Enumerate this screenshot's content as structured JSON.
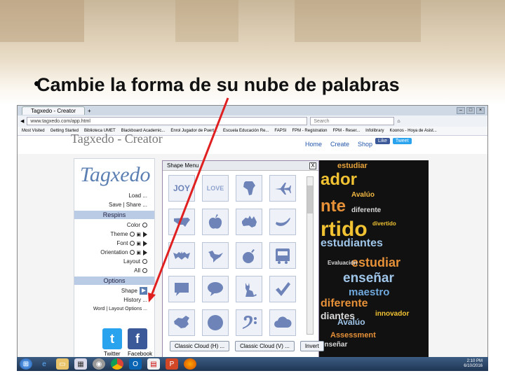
{
  "slide": {
    "bullet": "•",
    "title": "Cambie la forma de su nube de palabras"
  },
  "browser": {
    "tab_label": "Tagxedo - Creator",
    "new_tab": "+",
    "url": "www.tagxedo.com/app.html",
    "search_placeholder": "Search",
    "window_buttons": [
      "–",
      "□",
      "×"
    ],
    "bookmarks": [
      "Most Visited",
      "Getting Started",
      "Biblioteca UMET",
      "Blackboard Academic...",
      "Enrol Jugador de Puert...",
      "Escuela Educación Re...",
      "FAPSI",
      "FPM - Registration",
      "FPM - Reser...",
      "Infolibrary",
      "Koonos - Hoya de Asist..."
    ]
  },
  "site": {
    "logo": "Tagxedo - Creator",
    "nav": [
      "Home",
      "Create",
      "Shop"
    ],
    "social_small": [
      "Like",
      "Tweet"
    ]
  },
  "left_panel": {
    "logo": "Tagxedo",
    "load": "Load ...",
    "save_share": "Save | Share ...",
    "respins": "Respins",
    "color": "Color",
    "theme": "Theme",
    "font": "Font",
    "orientation": "Orientation",
    "layout": "Layout",
    "all": "All",
    "options": "Options",
    "shape": "Shape",
    "history": "History ...",
    "word_layout": "Word | Layout Options ...",
    "twitter": "Twitter",
    "facebook": "Facebook"
  },
  "shape_menu": {
    "title": "Shape Menu",
    "close": "X",
    "cells": [
      "JOY",
      "LOVE",
      "africa-icon",
      "airplane-icon",
      "usa-icon",
      "apple-icon",
      "australia-icon",
      "banana-icon",
      "bat-icon",
      "bird-icon",
      "bomb-icon",
      "bus-icon",
      "speech-bubble-icon",
      "speech-bubble-2-icon",
      "cat-icon",
      "checkmark-icon",
      "china-icon",
      "circle-icon",
      "bass-clef-icon",
      "cloud-icon"
    ],
    "buttons": [
      "Classic Cloud (H) ...",
      "Classic Cloud (V) ...",
      "Invert"
    ]
  },
  "word_cloud": [
    {
      "text": "estudiar",
      "color": "#e8a33a"
    },
    {
      "text": "ador",
      "color": "#f1c232"
    },
    {
      "text": "nte",
      "color": "#e69138"
    },
    {
      "text": "Avalúo",
      "color": "#f4b942"
    },
    {
      "text": "diferente",
      "color": "#d9d9d9"
    },
    {
      "text": "rtido",
      "color": "#f1c232"
    },
    {
      "text": "estudiantes",
      "color": "#9fc5e8"
    },
    {
      "text": "estudiar",
      "color": "#e69138"
    },
    {
      "text": "enseñar",
      "color": "#9fc5e8"
    },
    {
      "text": "maestro",
      "color": "#6fa8dc"
    },
    {
      "text": "diferente",
      "color": "#e69138"
    },
    {
      "text": "diantes",
      "color": "#d9d9d9"
    },
    {
      "text": "Avalúo",
      "color": "#9fc5e8"
    },
    {
      "text": "Assessment",
      "color": "#e69138"
    },
    {
      "text": "innovador",
      "color": "#f1c232"
    },
    {
      "text": "enseñar",
      "color": "#d9d9d9"
    },
    {
      "text": "divertido",
      "color": "#f1c232"
    },
    {
      "text": "Evaluación",
      "color": "#d9d9d9"
    }
  ],
  "taskbar": {
    "clock_time": "2:10 PM",
    "clock_date": "6/10/2016"
  },
  "colors": {
    "annotation_arrow": "#e02020",
    "accent": "#5b7fb2"
  }
}
